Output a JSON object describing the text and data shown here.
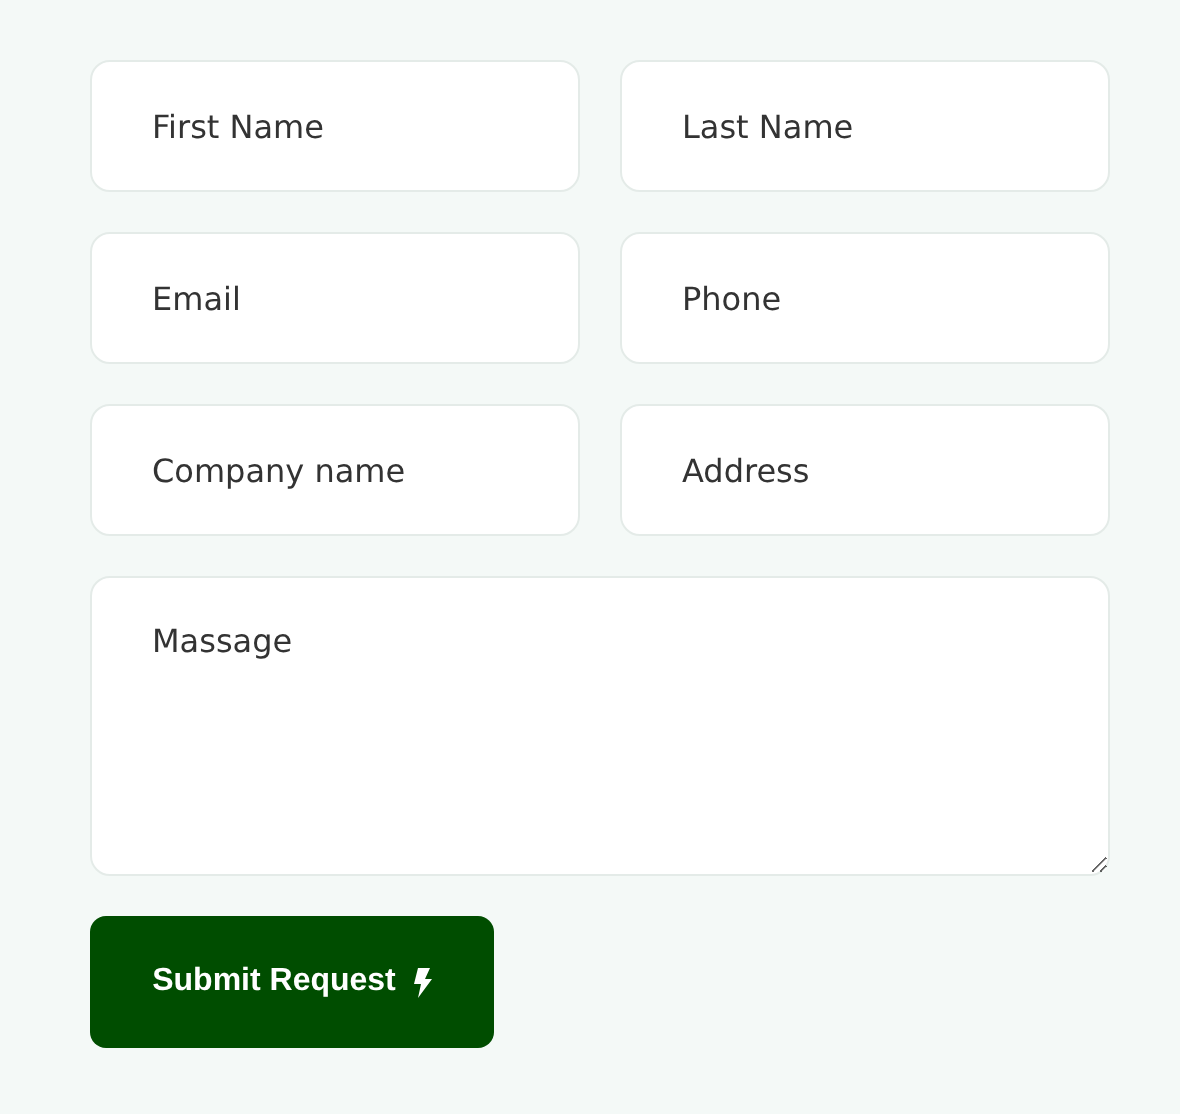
{
  "form": {
    "fields": [
      {
        "kind": "input",
        "placeholder": "First Name"
      },
      {
        "kind": "input",
        "placeholder": "Last Name"
      },
      {
        "kind": "input",
        "placeholder": "Email"
      },
      {
        "kind": "input",
        "placeholder": "Phone"
      },
      {
        "kind": "input",
        "placeholder": "Company name"
      },
      {
        "kind": "input",
        "placeholder": "Address"
      },
      {
        "kind": "textarea",
        "placeholder": "Massage"
      }
    ],
    "submit_button": {
      "label": "Submit Request"
    }
  }
}
